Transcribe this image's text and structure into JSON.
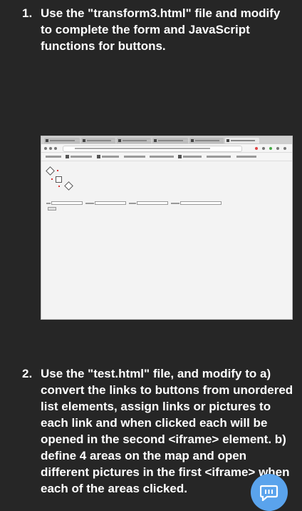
{
  "task1": {
    "number": "1.",
    "text": "Use the \"transform3.html\" file and modify to complete the form and JavaScript functions for buttons."
  },
  "task2": {
    "number": "2.",
    "text": "Use the \"test.html\" file, and modify to a) convert the links to buttons from unordered list elements, assign links or pictures to each link and when clicked each will be opened in the second <iframe> element. b) define 4 areas on the map and open different pictures in the first <iframe> when each of the areas clicked."
  },
  "colors": {
    "background": "#262626",
    "text": "#ffffff",
    "fab": "#5aa3ec"
  },
  "icons": {
    "fab": "chat-bubble-icon"
  }
}
